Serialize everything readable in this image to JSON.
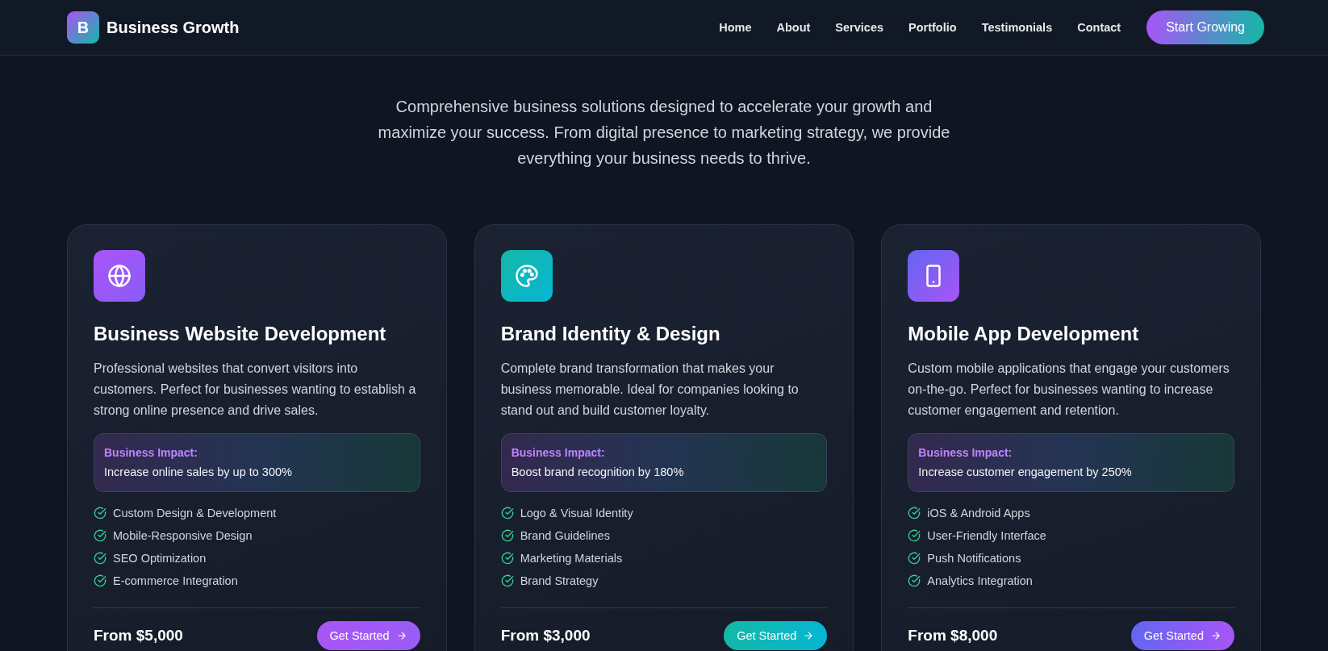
{
  "nav": {
    "logo_letter": "B",
    "brand": "Business Growth",
    "links": [
      {
        "label": "Home"
      },
      {
        "label": "About"
      },
      {
        "label": "Services"
      },
      {
        "label": "Portfolio"
      },
      {
        "label": "Testimonials"
      },
      {
        "label": "Contact"
      }
    ],
    "cta": "Start Growing"
  },
  "hero": {
    "description": "Comprehensive business solutions designed to accelerate your growth and maximize your success. From digital presence to marketing strategy, we provide everything your business needs to thrive."
  },
  "cards": [
    {
      "kind": "web",
      "title": "Business Website Development",
      "description": "Professional websites that convert visitors into customers. Perfect for businesses wanting to establish a strong online presence and drive sales.",
      "impact_label": "Business Impact:",
      "impact": "Increase online sales by up to 300%",
      "features": [
        "Custom Design & Development",
        "Mobile-Responsive Design",
        "SEO Optimization",
        "E-commerce Integration"
      ],
      "price": "From $5,000",
      "button": "Get Started"
    },
    {
      "kind": "brand",
      "title": "Brand Identity & Design",
      "description": "Complete brand transformation that makes your business memorable. Ideal for companies looking to stand out and build customer loyalty.",
      "impact_label": "Business Impact:",
      "impact": "Boost brand recognition by 180%",
      "features": [
        "Logo & Visual Identity",
        "Brand Guidelines",
        "Marketing Materials",
        "Brand Strategy"
      ],
      "price": "From $3,000",
      "button": "Get Started"
    },
    {
      "kind": "mobile",
      "title": "Mobile App Development",
      "description": "Custom mobile applications that engage your customers on-the-go. Perfect for businesses wanting to increase customer engagement and retention.",
      "impact_label": "Business Impact:",
      "impact": "Increase customer engagement by 250%",
      "features": [
        "iOS & Android Apps",
        "User-Friendly Interface",
        "Push Notifications",
        "Analytics Integration"
      ],
      "price": "From $8,000",
      "button": "Get Started"
    }
  ]
}
